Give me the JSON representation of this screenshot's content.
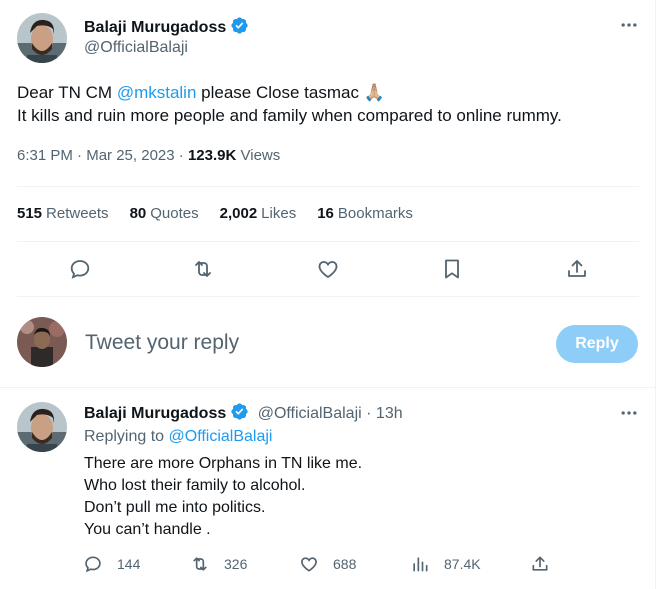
{
  "tweet": {
    "author_name": "Balaji Murugadoss",
    "author_handle": "@OfficialBalaji",
    "text_prefix": "Dear TN CM ",
    "mention": "@mkstalin",
    "text_suffix": " please Close tasmac 🙏🏼",
    "text_line2": "It kills and ruin more people and family when compared to online rummy.",
    "time": "6:31 PM",
    "date": "Mar 25, 2023",
    "views_count": "123.9K",
    "views_label": "Views"
  },
  "stats": {
    "retweets_count": "515",
    "retweets_label": "Retweets",
    "quotes_count": "80",
    "quotes_label": "Quotes",
    "likes_count": "2,002",
    "likes_label": "Likes",
    "bookmarks_count": "16",
    "bookmarks_label": "Bookmarks"
  },
  "compose": {
    "placeholder": "Tweet your reply",
    "reply_button": "Reply"
  },
  "reply": {
    "author_name": "Balaji Murugadoss",
    "author_handle": "@OfficialBalaji",
    "time_ago": "13h",
    "replying_to_label": "Replying to",
    "replying_to_handle": "@OfficialBalaji",
    "lines": [
      "There are more Orphans in TN like me.",
      "Who lost their family to alcohol.",
      "Don’t pull me into politics.",
      "You can’t handle ."
    ],
    "replies": "144",
    "retweets": "326",
    "likes": "688",
    "views": "87.4K"
  },
  "colors": {
    "accent": "#1d9bf0",
    "reply_button_disabled": "#8ecdf8",
    "secondary_text": "#536471"
  },
  "icons": [
    "verified-badge-icon",
    "more-icon",
    "reply-icon",
    "retweet-icon",
    "like-icon",
    "bookmark-icon",
    "share-icon",
    "views-icon"
  ]
}
